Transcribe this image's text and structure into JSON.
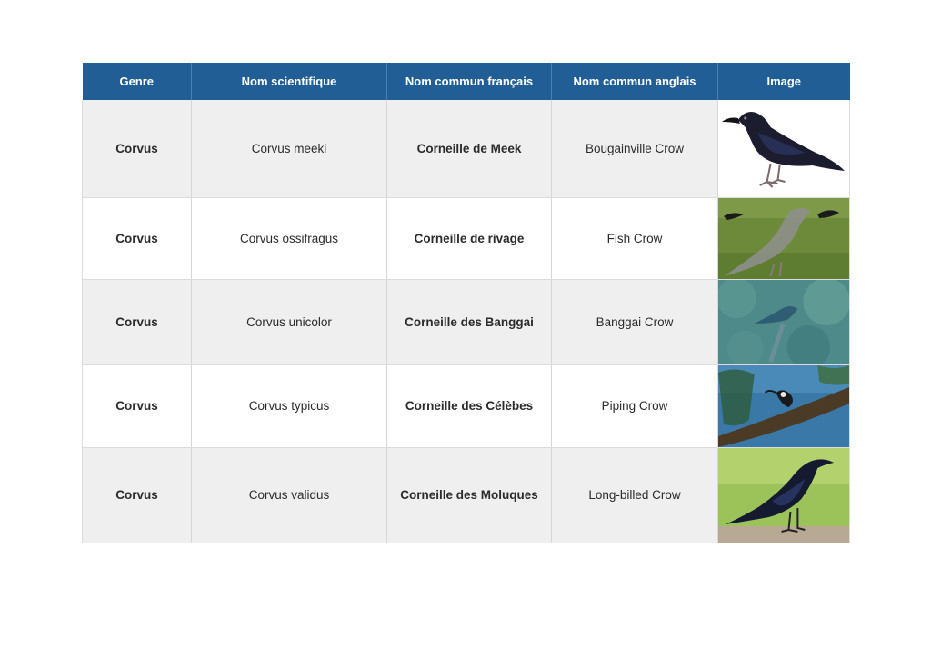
{
  "table": {
    "headers": [
      "Genre",
      "Nom scientifique",
      "Nom commun français",
      "Nom commun anglais",
      "Image"
    ],
    "rows": [
      {
        "genre": "Corvus",
        "scientific": "Corvus meeki",
        "french": "Corneille de Meek",
        "english": "Bougainville Crow",
        "image_icon": "crow-illustration-icon"
      },
      {
        "genre": "Corvus",
        "scientific": "Corvus ossifragus",
        "french": "Corneille de rivage",
        "english": "Fish Crow",
        "image_icon": "crow-photo-icon"
      },
      {
        "genre": "Corvus",
        "scientific": "Corvus unicolor",
        "french": "Corneille des Banggai",
        "english": "Banggai Crow",
        "image_icon": "crow-photo-icon"
      },
      {
        "genre": "Corvus",
        "scientific": "Corvus typicus",
        "french": "Corneille des Célèbes",
        "english": "Piping Crow",
        "image_icon": "crow-photo-icon"
      },
      {
        "genre": "Corvus",
        "scientific": "Corvus validus",
        "french": "Corneille des Moluques",
        "english": "Long-billed Crow",
        "image_icon": "crow-photo-icon"
      }
    ]
  },
  "colors": {
    "header_bg": "#225e96",
    "header_text": "#ffffff",
    "row_odd": "#efefef",
    "row_even": "#ffffff"
  }
}
